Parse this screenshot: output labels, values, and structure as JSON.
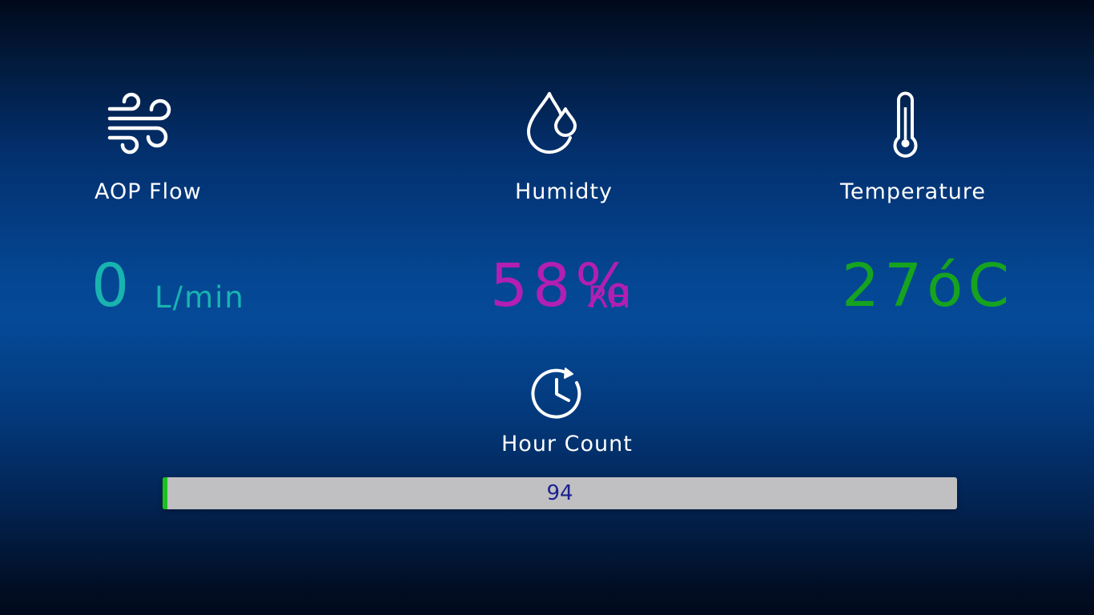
{
  "aop_flow": {
    "icon": "wind-icon",
    "label": "AOP Flow",
    "value": "0",
    "unit": "L/min",
    "value_color": "#19b3b0"
  },
  "humidity": {
    "icon": "water-drops-icon",
    "label": "Humidty",
    "value": "58%",
    "unit": "RH",
    "value_color": "#b21fb2"
  },
  "temperature": {
    "icon": "thermometer-icon",
    "label": "Temperature",
    "value": "27óC",
    "value_color": "#16a31f"
  },
  "hour_count": {
    "icon": "clock-refresh-icon",
    "label": "Hour Count",
    "value": "94",
    "bar_fill_color": "#1cc21c",
    "bar_track_color": "#c0bfc2",
    "text_color": "#1a2290"
  }
}
